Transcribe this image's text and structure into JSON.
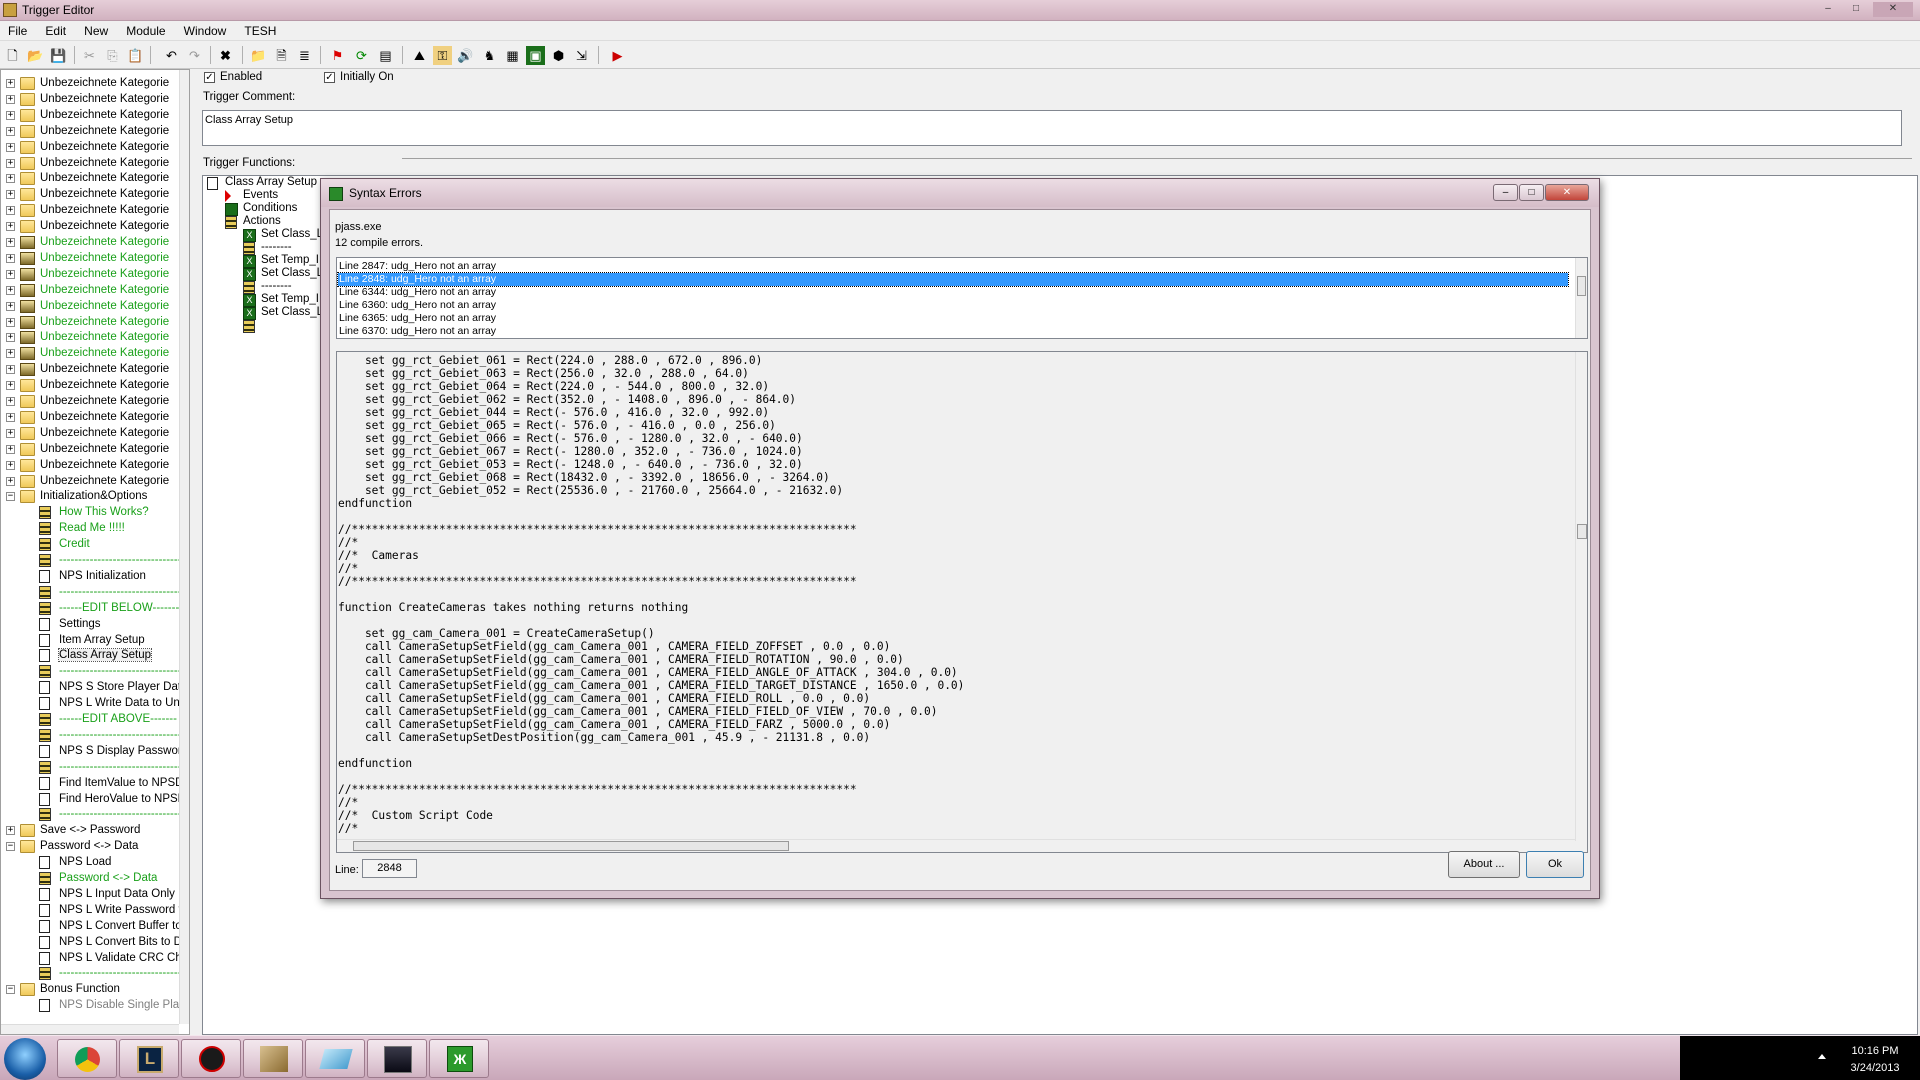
{
  "window": {
    "title": "Trigger Editor",
    "min": "–",
    "max": "□",
    "close": "✕"
  },
  "menu": [
    "File",
    "Edit",
    "New",
    "Module",
    "Window",
    "TESH"
  ],
  "tree": {
    "items": [
      {
        "label": "Unbezeichnete Kategorie",
        "kind": "folder",
        "color": "black"
      },
      {
        "label": "Unbezeichnete Kategorie",
        "kind": "folder",
        "color": "black"
      },
      {
        "label": "Unbezeichnete Kategorie",
        "kind": "folder",
        "color": "black"
      },
      {
        "label": "Unbezeichnete Kategorie",
        "kind": "folder",
        "color": "black"
      },
      {
        "label": "Unbezeichnete Kategorie",
        "kind": "folder",
        "color": "black"
      },
      {
        "label": "Unbezeichnete Kategorie",
        "kind": "folder",
        "color": "black"
      },
      {
        "label": "Unbezeichnete Kategorie",
        "kind": "folder",
        "color": "black"
      },
      {
        "label": "Unbezeichnete Kategorie",
        "kind": "folder",
        "color": "black"
      },
      {
        "label": "Unbezeichnete Kategorie",
        "kind": "folder",
        "color": "black"
      },
      {
        "label": "Unbezeichnete Kategorie",
        "kind": "folder",
        "color": "black"
      },
      {
        "label": "Unbezeichnete Kategorie",
        "kind": "cfolder",
        "color": "green"
      },
      {
        "label": "Unbezeichnete Kategorie",
        "kind": "cfolder",
        "color": "green"
      },
      {
        "label": "Unbezeichnete Kategorie",
        "kind": "cfolder",
        "color": "green"
      },
      {
        "label": "Unbezeichnete Kategorie",
        "kind": "cfolder",
        "color": "green"
      },
      {
        "label": "Unbezeichnete Kategorie",
        "kind": "cfolder",
        "color": "green"
      },
      {
        "label": "Unbezeichnete Kategorie",
        "kind": "cfolder",
        "color": "green"
      },
      {
        "label": "Unbezeichnete Kategorie",
        "kind": "cfolder",
        "color": "green"
      },
      {
        "label": "Unbezeichnete Kategorie",
        "kind": "cfolder",
        "color": "green"
      },
      {
        "label": "Unbezeichnete Kategorie",
        "kind": "cfolder",
        "color": "black"
      },
      {
        "label": "Unbezeichnete Kategorie",
        "kind": "folder",
        "color": "black"
      },
      {
        "label": "Unbezeichnete Kategorie",
        "kind": "folder",
        "color": "black"
      },
      {
        "label": "Unbezeichnete Kategorie",
        "kind": "folder",
        "color": "black"
      },
      {
        "label": "Unbezeichnete Kategorie",
        "kind": "folder",
        "color": "black"
      },
      {
        "label": "Unbezeichnete Kategorie",
        "kind": "folder",
        "color": "black"
      },
      {
        "label": "Unbezeichnete Kategorie",
        "kind": "folder",
        "color": "black"
      },
      {
        "label": "Unbezeichnete Kategorie",
        "kind": "folder",
        "color": "black"
      },
      {
        "label": "Initialization&Options",
        "kind": "folder",
        "color": "black",
        "open": true
      },
      {
        "label": "How This Works?",
        "kind": "cdoc",
        "color": "green",
        "indent": 1
      },
      {
        "label": "Read Me !!!!!",
        "kind": "cdoc",
        "color": "green",
        "indent": 1
      },
      {
        "label": "Credit",
        "kind": "cdoc",
        "color": "green",
        "indent": 1
      },
      {
        "label": "--------------------------------",
        "kind": "cdoc",
        "color": "green",
        "indent": 1
      },
      {
        "label": "NPS Initialization",
        "kind": "doc",
        "color": "black",
        "indent": 1
      },
      {
        "label": "--------------------------------",
        "kind": "cdoc",
        "color": "green",
        "indent": 1
      },
      {
        "label": "------EDIT BELOW-------",
        "kind": "cdoc",
        "color": "green",
        "indent": 1
      },
      {
        "label": "Settings",
        "kind": "doc",
        "color": "black",
        "indent": 1
      },
      {
        "label": "Item Array Setup",
        "kind": "doc",
        "color": "black",
        "indent": 1
      },
      {
        "label": "Class Array Setup",
        "kind": "doc",
        "color": "black",
        "indent": 1,
        "selected": true
      },
      {
        "label": "--------------------------------",
        "kind": "cdoc",
        "color": "green",
        "indent": 1
      },
      {
        "label": "NPS S Store Player Data",
        "kind": "doc",
        "color": "black",
        "indent": 1
      },
      {
        "label": "NPS L Write Data to Unit",
        "kind": "doc",
        "color": "black",
        "indent": 1
      },
      {
        "label": "------EDIT ABOVE-------",
        "kind": "cdoc",
        "color": "green",
        "indent": 1
      },
      {
        "label": "--------------------------------",
        "kind": "cdoc",
        "color": "green",
        "indent": 1
      },
      {
        "label": "NPS S Display Password",
        "kind": "doc",
        "color": "black",
        "indent": 1
      },
      {
        "label": "--------------------------------",
        "kind": "cdoc",
        "color": "green",
        "indent": 1
      },
      {
        "label": "Find ItemValue to NPSD",
        "kind": "doc",
        "color": "black",
        "indent": 1
      },
      {
        "label": "Find HeroValue to NPSD",
        "kind": "doc",
        "color": "black",
        "indent": 1
      },
      {
        "label": "--------------------------------",
        "kind": "cdoc",
        "color": "green",
        "indent": 1
      },
      {
        "label": "Save <-> Password",
        "kind": "folder",
        "color": "black"
      },
      {
        "label": "Password <-> Data",
        "kind": "folder",
        "color": "black",
        "open": true
      },
      {
        "label": "NPS Load",
        "kind": "doc",
        "color": "black",
        "indent": 1
      },
      {
        "label": "Password <-> Data",
        "kind": "cdoc",
        "color": "green",
        "indent": 1
      },
      {
        "label": "NPS L Input Data Only",
        "kind": "doc",
        "color": "black",
        "indent": 1
      },
      {
        "label": "NPS L Write Password to",
        "kind": "doc",
        "color": "black",
        "indent": 1
      },
      {
        "label": "NPS L Convert Buffer to",
        "kind": "doc",
        "color": "black",
        "indent": 1
      },
      {
        "label": "NPS L Convert Bits to Da",
        "kind": "doc",
        "color": "black",
        "indent": 1
      },
      {
        "label": "NPS L Validate CRC Che",
        "kind": "doc",
        "color": "black",
        "indent": 1
      },
      {
        "label": "--------------------------------",
        "kind": "cdoc",
        "color": "green",
        "indent": 1
      },
      {
        "label": "Bonus Function",
        "kind": "folder",
        "color": "black",
        "open": true
      },
      {
        "label": "NPS Disable Single Play",
        "kind": "doc",
        "color": "gray",
        "indent": 1
      }
    ]
  },
  "trigger": {
    "enabled_label": "Enabled",
    "initially_on_label": "Initially On",
    "comment_label": "Trigger Comment:",
    "comment_value": "Class Array Setup",
    "functions_label": "Trigger Functions:",
    "functions": [
      {
        "label": "Class Array Setup",
        "kind": "doc",
        "indent": 0
      },
      {
        "label": "Events",
        "kind": "evt",
        "indent": 1
      },
      {
        "label": "Conditions",
        "kind": "cond",
        "indent": 1
      },
      {
        "label": "Actions",
        "kind": "acts",
        "indent": 1
      },
      {
        "label": "Set Class_L",
        "kind": "act",
        "indent": 2
      },
      {
        "label": "--------",
        "kind": "cmt",
        "indent": 2
      },
      {
        "label": "Set Temp_I",
        "kind": "act",
        "indent": 2
      },
      {
        "label": "Set Class_L",
        "kind": "act",
        "indent": 2
      },
      {
        "label": "--------",
        "kind": "cmt",
        "indent": 2
      },
      {
        "label": "Set Temp_I",
        "kind": "act",
        "indent": 2
      },
      {
        "label": "Set Class_L",
        "kind": "act",
        "indent": 2
      },
      {
        "label": "",
        "kind": "cmt",
        "indent": 2
      }
    ]
  },
  "dialog": {
    "title": "Syntax Errors",
    "source": "pjass.exe",
    "summary": "12 compile errors.",
    "errors": [
      "Line 2847:  udg_Hero not an array",
      "Line 2848:  udg_Hero not an array",
      "Line 6344:  udg_Hero not an array",
      "Line 6360:  udg_Hero not an array",
      "Line 6365:  udg_Hero not an array",
      "Line 6370:  udg_Hero not an array"
    ],
    "selected_error": 1,
    "code": "    set gg_rct_Gebiet_061 = Rect(224.0 , 288.0 , 672.0 , 896.0)\n    set gg_rct_Gebiet_063 = Rect(256.0 , 32.0 , 288.0 , 64.0)\n    set gg_rct_Gebiet_064 = Rect(224.0 , - 544.0 , 800.0 , 32.0)\n    set gg_rct_Gebiet_062 = Rect(352.0 , - 1408.0 , 896.0 , - 864.0)\n    set gg_rct_Gebiet_044 = Rect(- 576.0 , 416.0 , 32.0 , 992.0)\n    set gg_rct_Gebiet_065 = Rect(- 576.0 , - 416.0 , 0.0 , 256.0)\n    set gg_rct_Gebiet_066 = Rect(- 576.0 , - 1280.0 , 32.0 , - 640.0)\n    set gg_rct_Gebiet_067 = Rect(- 1280.0 , 352.0 , - 736.0 , 1024.0)\n    set gg_rct_Gebiet_053 = Rect(- 1248.0 , - 640.0 , - 736.0 , 32.0)\n    set gg_rct_Gebiet_068 = Rect(18432.0 , - 3392.0 , 18656.0 , - 3264.0)\n    set gg_rct_Gebiet_052 = Rect(25536.0 , - 21760.0 , 25664.0 , - 21632.0)\nendfunction\n\n//***************************************************************************\n//*\n//*  Cameras\n//*\n//***************************************************************************\n\nfunction CreateCameras takes nothing returns nothing\n\n    set gg_cam_Camera_001 = CreateCameraSetup()\n    call CameraSetupSetField(gg_cam_Camera_001 , CAMERA_FIELD_ZOFFSET , 0.0 , 0.0)\n    call CameraSetupSetField(gg_cam_Camera_001 , CAMERA_FIELD_ROTATION , 90.0 , 0.0)\n    call CameraSetupSetField(gg_cam_Camera_001 , CAMERA_FIELD_ANGLE_OF_ATTACK , 304.0 , 0.0)\n    call CameraSetupSetField(gg_cam_Camera_001 , CAMERA_FIELD_TARGET_DISTANCE , 1650.0 , 0.0)\n    call CameraSetupSetField(gg_cam_Camera_001 , CAMERA_FIELD_ROLL , 0.0 , 0.0)\n    call CameraSetupSetField(gg_cam_Camera_001 , CAMERA_FIELD_FIELD_OF_VIEW , 70.0 , 0.0)\n    call CameraSetupSetField(gg_cam_Camera_001 , CAMERA_FIELD_FARZ , 5000.0 , 0.0)\n    call CameraSetupSetDestPosition(gg_cam_Camera_001 , 45.9 , - 21131.8 , 0.0)\n\nendfunction\n\n//***************************************************************************\n//*\n//*  Custom Script Code\n//*",
    "line_label": "Line:",
    "line_value": "2848",
    "about_button": "About ...",
    "ok_button": "Ok"
  },
  "taskbar": {
    "time": "10:16 PM",
    "date": "3/24/2013",
    "apps": [
      "start-orb",
      "chrome",
      "league-of-legends",
      "game-client",
      "world-editor",
      "paint",
      "warcraft",
      "jass-helper"
    ]
  },
  "colors": {
    "selection": "#3399ff",
    "green_text": "#1aa01a",
    "title_pink": "#d5bdc9"
  }
}
